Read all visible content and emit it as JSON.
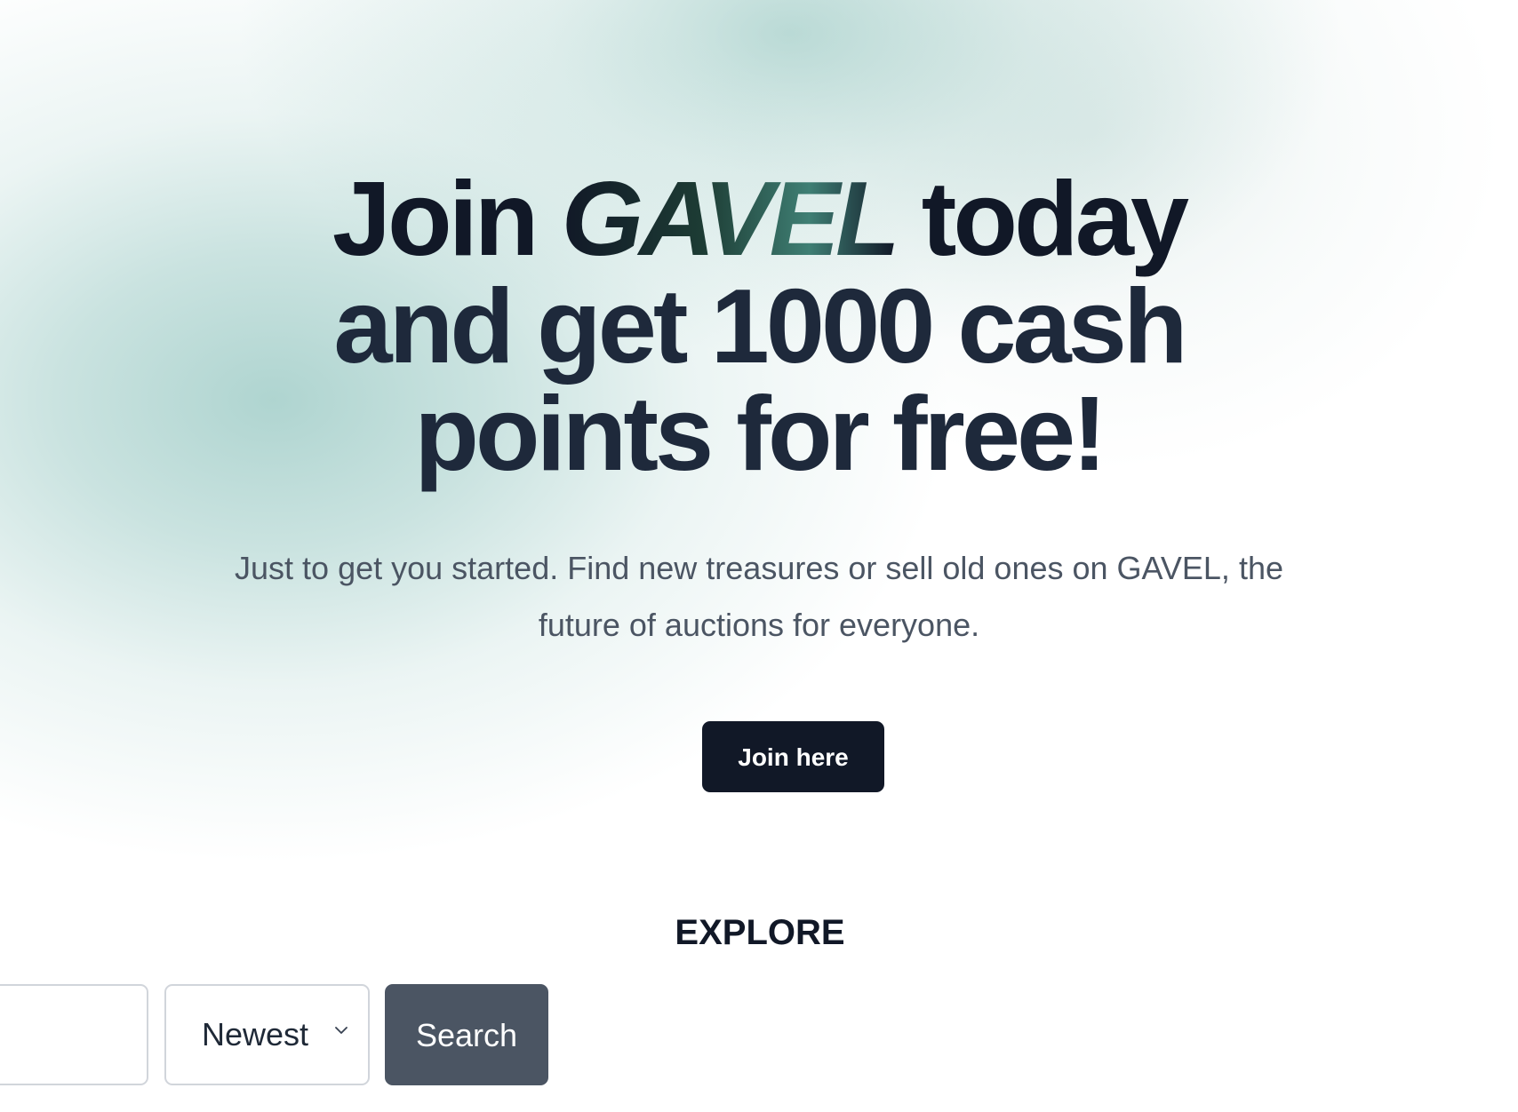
{
  "hero": {
    "headline_join": "Join",
    "brand": "GAVEL",
    "headline_today": "today",
    "headline_line_2": "and get 1000 cash",
    "headline_line_3": "points for free!",
    "subtitle": "Just to get you started. Find new treasures or sell old ones on GAVEL, the future of auctions for everyone.",
    "join_button_label": "Join here"
  },
  "explore": {
    "title": "EXPLORE",
    "search_value": "",
    "search_placeholder": "",
    "sort_selected": "Newest",
    "search_button_label": "Search"
  },
  "icons": {
    "dropdown": "chevron-down-icon"
  },
  "colors": {
    "primary_text": "#111827",
    "headline_text": "#1e293b",
    "body_text": "#4b5563",
    "join_button": "#111827",
    "search_button": "#4b5563",
    "gradient_accent": "#90c4be",
    "brand_gradient_accent": "#3f7f74"
  }
}
